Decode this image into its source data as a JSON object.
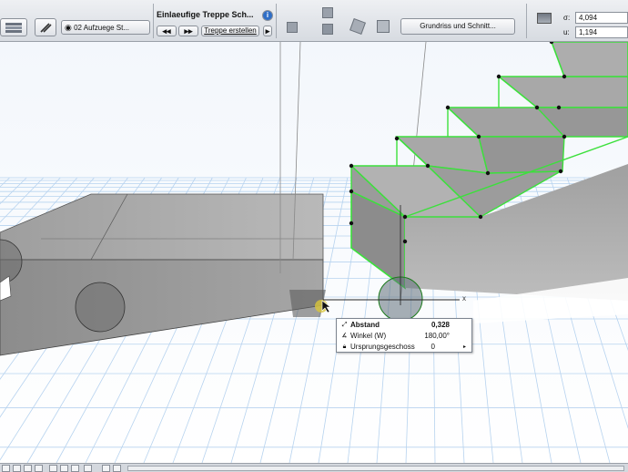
{
  "toolbar": {
    "view_preset": "02 Aufzuege St...",
    "tool_name": "Einlaeufige Treppe Sch...",
    "create_stair": "Treppe erstellen",
    "view_button": "Grundriss und Schnitt...",
    "coord_x_label": "σ:",
    "coord_x_value": "4,094",
    "coord_y_label": "u:",
    "coord_y_value": "1,194",
    "info_icon": "info-icon"
  },
  "canvas": {
    "axis_label": "x",
    "colors": {
      "selection": "#3ce03c",
      "grid": "#b7d3ef",
      "concrete": "#a9a9a9"
    }
  },
  "tracker": {
    "rows": [
      {
        "icon": "distance-icon",
        "label": "Abstand",
        "value": "0,328"
      },
      {
        "icon": "angle-icon",
        "label": "Winkel (W)",
        "value": "180,00°"
      },
      {
        "icon": "lock-icon",
        "label": "Ursprungsgeschoss",
        "value": "0"
      }
    ]
  }
}
